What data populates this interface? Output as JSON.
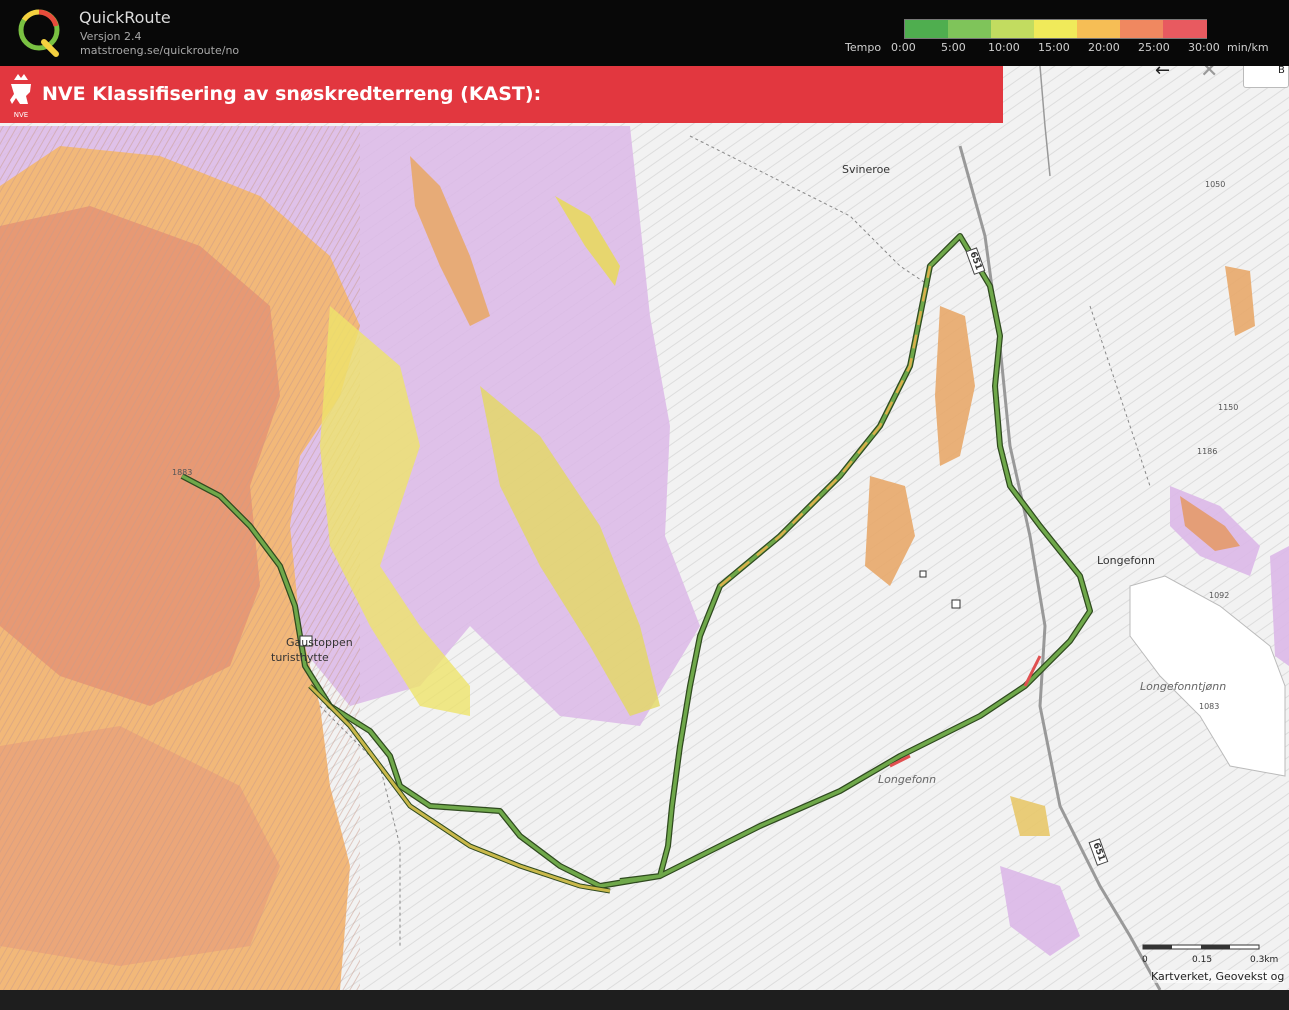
{
  "app": {
    "name": "QuickRoute",
    "version": "Versjon 2.4",
    "url": "matstroeng.se/quickroute/no"
  },
  "tempo": {
    "label": "Tempo",
    "ticks": [
      "0:00",
      "5:00",
      "10:00",
      "15:00",
      "20:00",
      "25:00",
      "30:00"
    ],
    "unit": "min/km",
    "colors": [
      "#4fae4f",
      "#7fc45a",
      "#c2dc60",
      "#f0ea5a",
      "#f6be55",
      "#f08860",
      "#e85a60"
    ]
  },
  "banner": {
    "org": "NVE",
    "title": "NVE Klassifisering av snøskredterreng (KAST):",
    "color": "#e2373f"
  },
  "map": {
    "places": {
      "svineroe": "Svineroe",
      "longefonn": "Longefonn",
      "gaustoppen": "Gaustoppen",
      "turisthytte": "turisthytte",
      "longefonntjonn": "Longefonntjønn",
      "longefonn_slope": "Longefonn"
    },
    "elevations": {
      "e1883": "1883",
      "e1186": "1186",
      "e1092": "1092",
      "e1083": "1083",
      "e1050": "1050",
      "e1150": "1150"
    },
    "road_number": "651",
    "scale": {
      "zero": "0",
      "mid": "0.15",
      "end": "0.3km"
    },
    "attribution": "Kartverket, Geovekst og",
    "controls": {
      "menu_letter": "B"
    }
  }
}
